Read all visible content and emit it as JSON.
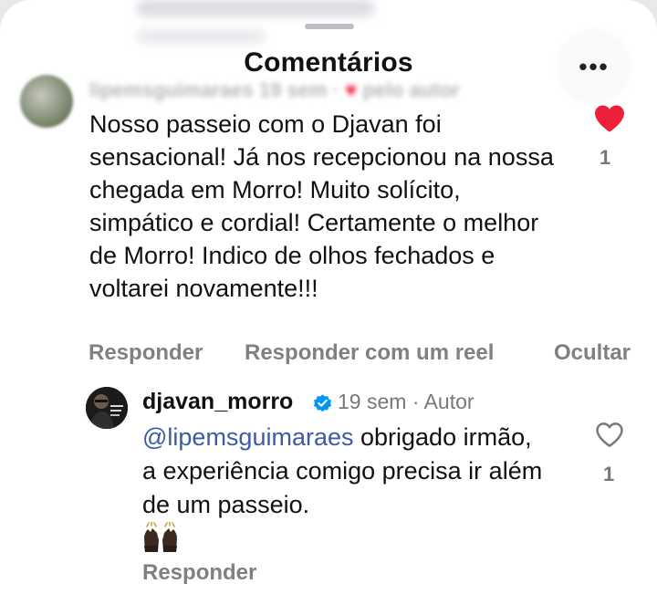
{
  "sheet": {
    "title": "Comentários",
    "more_label": "•••"
  },
  "comment": {
    "author_blurred": "lipemsguimaraes",
    "time_blurred": "19 sem",
    "liked_by_blurred": "pelo autor",
    "text": "Nosso passeio com o Djavan foi sensacional! Já nos recepcionou na nossa chegada em Morro! Muito solícito, simpático e cordial! Certamente o melhor de Morro! Indico de olhos fechados e voltarei novamente!!!",
    "like_count": "1",
    "actions": {
      "reply": "Responder",
      "reply_reel": "Responder com um reel",
      "hide": "Ocultar"
    }
  },
  "reply": {
    "username": "djavan_morro",
    "meta": "19 sem · Autor",
    "mention": "@lipemsguimaraes",
    "text": " obrigado irmão, a experiência comigo precisa ir além de um passeio.",
    "emoji": "🙌🏿",
    "like_count": "1",
    "action_reply": "Responder"
  },
  "colors": {
    "heart_red": "#ee1f3a",
    "mention_blue": "#3c5aa6",
    "verified_blue": "#0095f6",
    "muted_gray": "#808080"
  }
}
